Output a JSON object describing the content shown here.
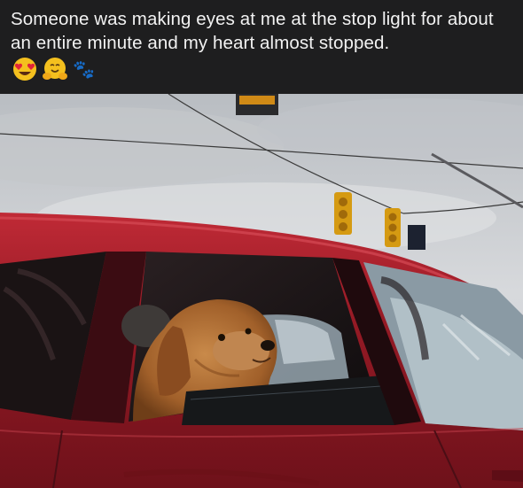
{
  "post": {
    "caption": "Someone was making eyes at me at the stop light for about an entire minute and my heart almost stopped.",
    "emojis": [
      "heart-eyes-emoji",
      "hugging-face-emoji",
      "paw-prints-emoji"
    ],
    "paw_glyph": "🐾"
  },
  "photo": {
    "subject": "dog",
    "car_color": "#9c1b24",
    "sky_color": "#d5d7da"
  }
}
